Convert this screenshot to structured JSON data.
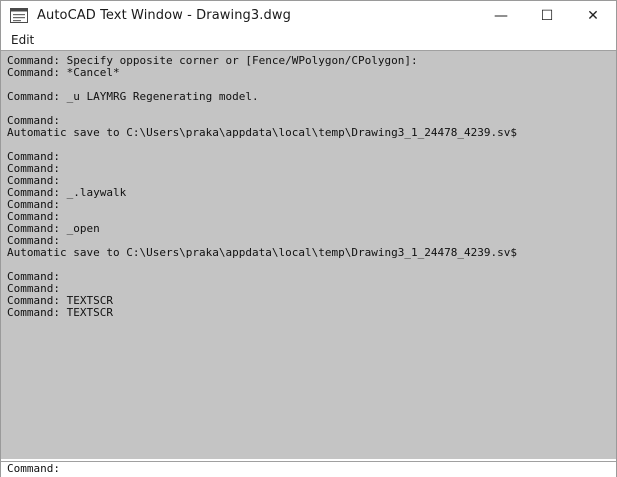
{
  "window": {
    "title": "AutoCAD Text Window - Drawing3.dwg",
    "icon": "text-window-icon",
    "controls": {
      "minimize": "—",
      "maximize": "☐",
      "close": "✕"
    }
  },
  "menu": {
    "items": [
      {
        "label": "Edit"
      }
    ]
  },
  "console": {
    "lines": [
      "Command: Specify opposite corner or [Fence/WPolygon/CPolygon]:",
      "Command: *Cancel*",
      "",
      "Command: _u LAYMRG Regenerating model.",
      "",
      "Command:",
      "Automatic save to C:\\Users\\praka\\appdata\\local\\temp\\Drawing3_1_24478_4239.sv$",
      "",
      "Command:",
      "Command:",
      "Command:",
      "Command: _.laywalk",
      "Command:",
      "Command:",
      "Command: _open",
      "Command:",
      "Automatic save to C:\\Users\\praka\\appdata\\local\\temp\\Drawing3_1_24478_4239.sv$",
      "",
      "Command:",
      "Command:",
      "Command: TEXTSCR",
      "Command: TEXTSCR"
    ]
  },
  "command_prompt": {
    "text": "Command:"
  }
}
